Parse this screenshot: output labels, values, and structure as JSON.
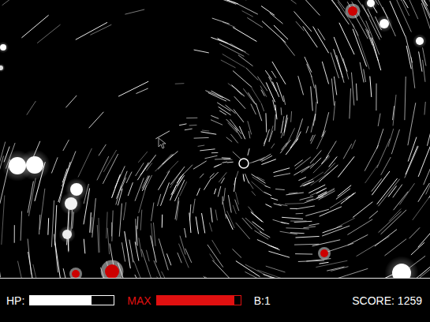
{
  "hud": {
    "hp": {
      "label": "HP:",
      "level": 0.73
    },
    "max": {
      "label": "MAX",
      "level": 0.93
    },
    "bombs": "B:1",
    "score": "SCORE: 1259"
  }
}
